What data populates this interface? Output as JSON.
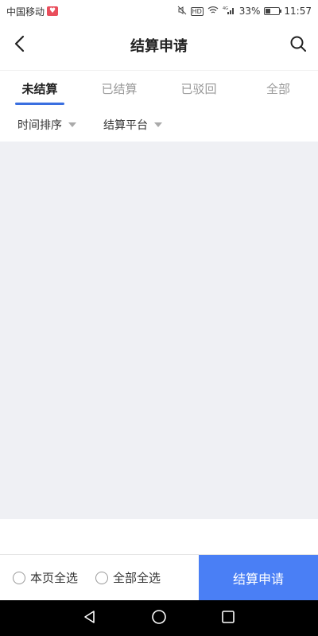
{
  "status_bar": {
    "carrier": "中国移动",
    "carrier_badge_icon": "heart-icon",
    "hd_label": "HD",
    "signal_label": "4G",
    "battery": "33%",
    "battery_level": 0.33,
    "time": "11:57"
  },
  "header": {
    "title": "结算申请",
    "back_icon": "chevron-left-icon",
    "search_icon": "search-icon"
  },
  "tabs": [
    {
      "label": "未结算",
      "active": true
    },
    {
      "label": "已结算",
      "active": false
    },
    {
      "label": "已驳回",
      "active": false
    },
    {
      "label": "全部",
      "active": false
    }
  ],
  "filters": [
    {
      "label": "时间排序",
      "icon": "caret-down-icon"
    },
    {
      "label": "结算平台",
      "icon": "caret-down-icon"
    }
  ],
  "bottom_bar": {
    "select_page_label": "本页全选",
    "select_all_label": "全部全选",
    "submit_label": "结算申请"
  },
  "colors": {
    "accent": "#4a7ff5",
    "tab_indicator": "#3a6fe0",
    "content_bg": "#eff0f4"
  },
  "nav_bar": {
    "back_icon": "triangle-back-icon",
    "home_icon": "circle-home-icon",
    "recents_icon": "square-recents-icon"
  }
}
